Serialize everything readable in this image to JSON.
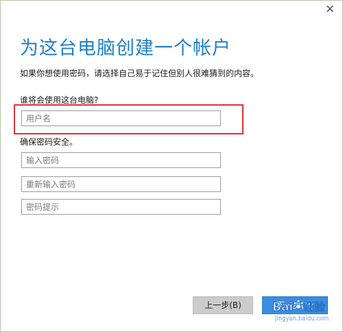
{
  "window": {
    "close_glyph": "✕"
  },
  "page": {
    "title": "为这台电脑创建一个帐户",
    "description": "如果你想使用密码，请选择自己易于记住但别人很难猜到的内容。"
  },
  "form": {
    "who_label": "谁将会使用这台电脑?",
    "username_placeholder": "用户名",
    "secure_label": "确保密码安全。",
    "password_placeholder": "输入密码",
    "confirm_placeholder": "重新输入密码",
    "hint_placeholder": "密码提示"
  },
  "buttons": {
    "back_label": "上一步(B)",
    "next_label": "下一步(N)"
  },
  "annotation": {
    "highlight_color": "#e0303a"
  },
  "watermark": {
    "brand": "Baidu 经验",
    "url": "jingyan.baidu.com"
  },
  "colors": {
    "title": "#1f7fcc",
    "primary_button": "#3a8ee0",
    "secondary_button": "#cccccc"
  }
}
